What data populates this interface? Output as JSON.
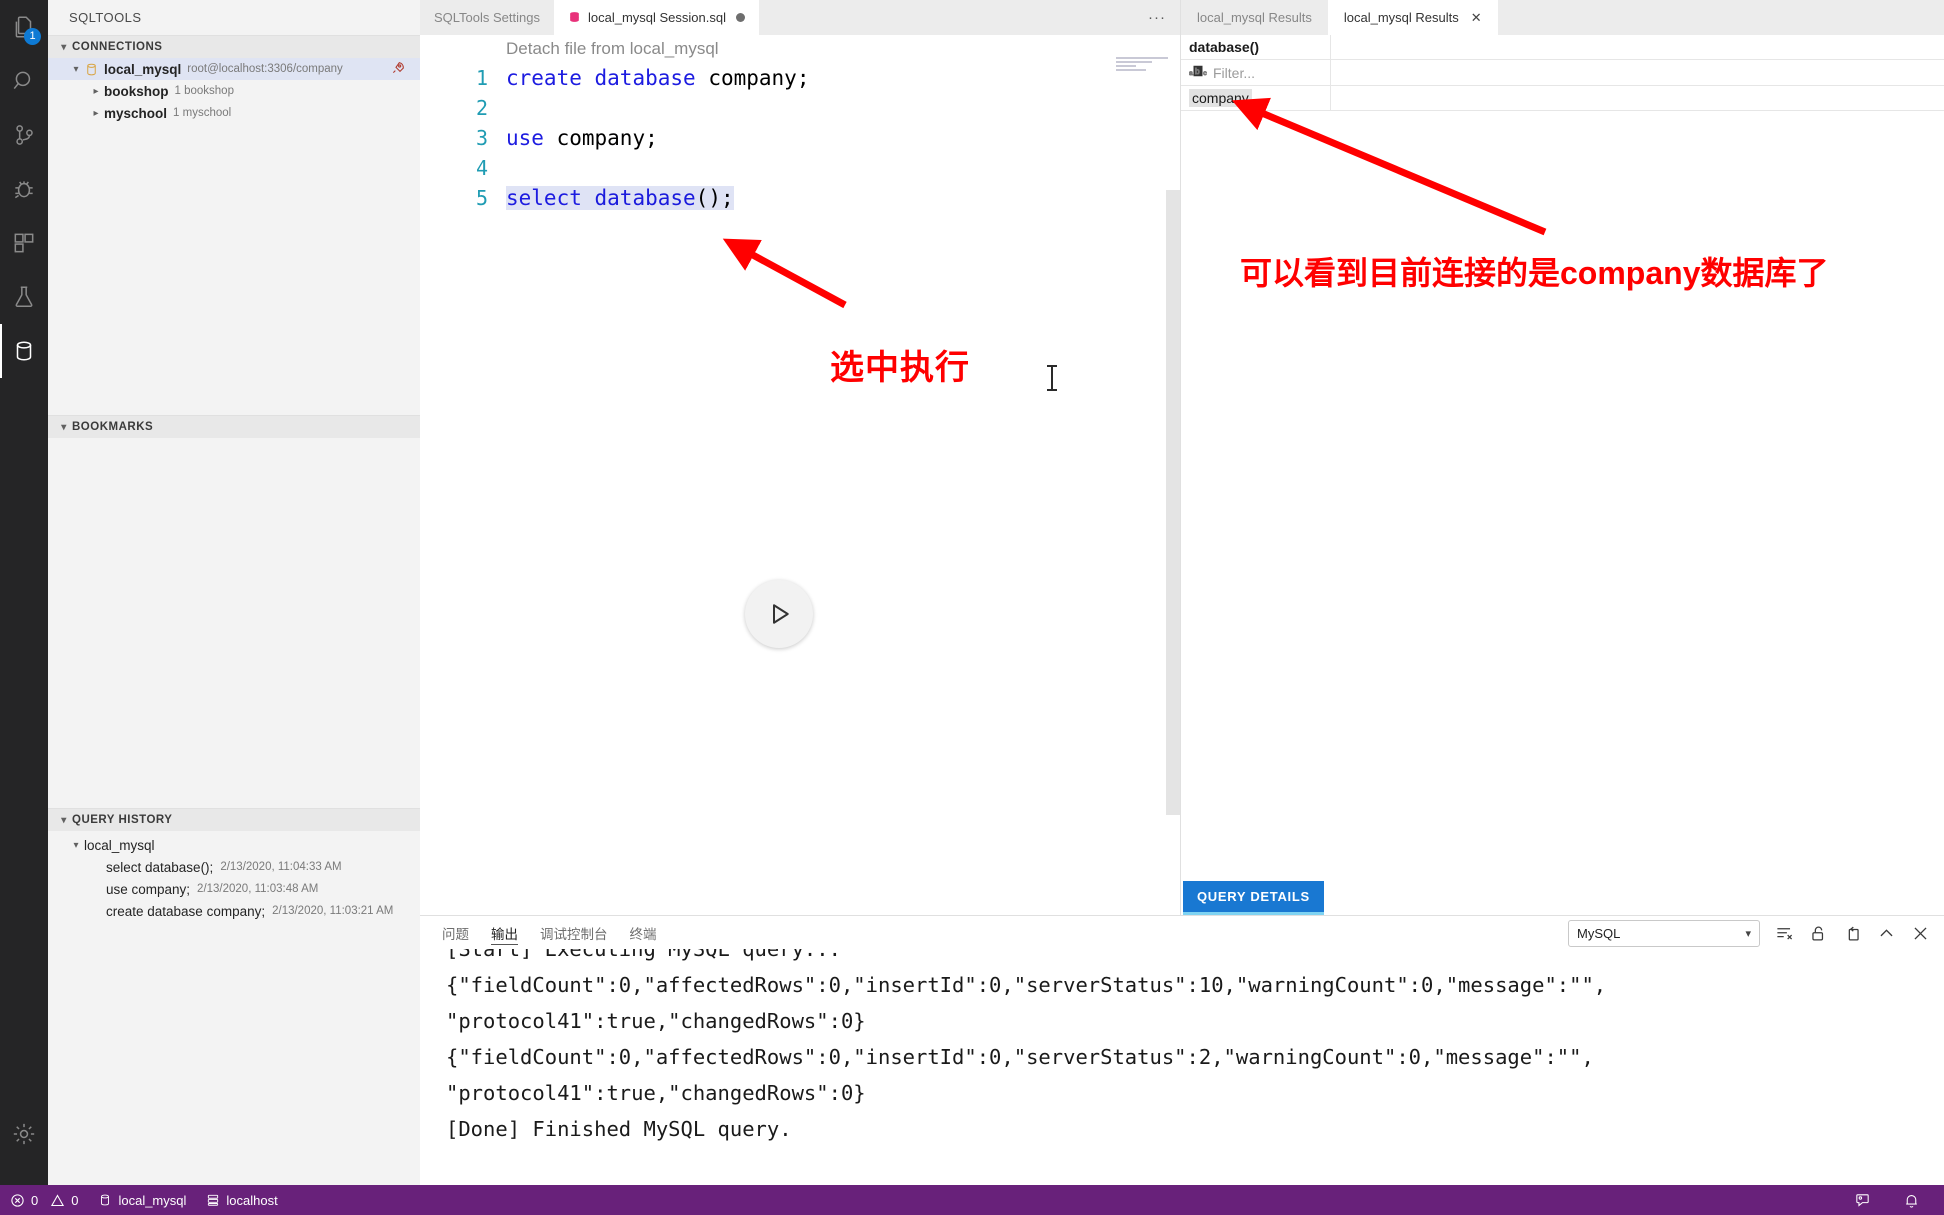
{
  "activitybar": {
    "items": [
      {
        "name": "explorer-icon",
        "label": "Explorer",
        "badge": "1"
      },
      {
        "name": "search-icon",
        "label": "Search",
        "badge": ""
      },
      {
        "name": "source-control-icon",
        "label": "Source Control",
        "badge": ""
      },
      {
        "name": "run-debug-icon",
        "label": "Run and Debug",
        "badge": ""
      },
      {
        "name": "extensions-icon",
        "label": "Extensions",
        "badge": ""
      },
      {
        "name": "testing-flask-icon",
        "label": "Testing",
        "badge": ""
      },
      {
        "name": "database-icon",
        "label": "SQLTools",
        "badge": ""
      }
    ],
    "settings_label": "Manage"
  },
  "sidebar": {
    "title": "SQLTOOLS",
    "sections": {
      "connections": {
        "label": "CONNECTIONS",
        "items": [
          {
            "name": "local_mysql",
            "detail": "root@localhost:3306/company",
            "level": 0,
            "expanded": true,
            "selected": true,
            "icon": "database-icon",
            "action_icon": "rocket-icon"
          },
          {
            "name": "bookshop",
            "detail": "1 bookshop",
            "level": 1,
            "expanded": false,
            "selected": false,
            "icon": "chevron-right-icon",
            "action_icon": ""
          },
          {
            "name": "myschool",
            "detail": "1 myschool",
            "level": 1,
            "expanded": false,
            "selected": false,
            "icon": "chevron-right-icon",
            "action_icon": ""
          }
        ]
      },
      "bookmarks": {
        "label": "BOOKMARKS",
        "items": []
      },
      "query_history": {
        "label": "QUERY HISTORY",
        "group": "local_mysql",
        "items": [
          {
            "query": "select database();",
            "time": "2/13/2020, 11:04:33 AM"
          },
          {
            "query": "use company;",
            "time": "2/13/2020, 11:03:48 AM"
          },
          {
            "query": "create database company;",
            "time": "2/13/2020, 11:03:21 AM"
          }
        ]
      }
    }
  },
  "editor": {
    "tabs": [
      {
        "label": "SQLTools Settings",
        "active": false,
        "dirty": false,
        "icon": ""
      },
      {
        "label": "local_mysql Session.sql",
        "active": true,
        "dirty": true,
        "icon": "sql-file-icon"
      }
    ],
    "overflow_label": "···",
    "codelens": "Detach file from local_mysql",
    "lines": [
      {
        "num": "1",
        "tokens": [
          {
            "t": "create",
            "c": "kw"
          },
          {
            "t": " ",
            "c": ""
          },
          {
            "t": "database",
            "c": "kw"
          },
          {
            "t": " company;",
            "c": ""
          }
        ],
        "selected": false
      },
      {
        "num": "2",
        "tokens": [],
        "selected": false
      },
      {
        "num": "3",
        "tokens": [
          {
            "t": "use",
            "c": "kw"
          },
          {
            "t": " company;",
            "c": ""
          }
        ],
        "selected": false
      },
      {
        "num": "4",
        "tokens": [],
        "selected": false
      },
      {
        "num": "5",
        "tokens": [
          {
            "t": "select",
            "c": "kw"
          },
          {
            "t": " ",
            "c": ""
          },
          {
            "t": "database",
            "c": "fn"
          },
          {
            "t": "();",
            "c": ""
          }
        ],
        "selected": true
      }
    ],
    "run_button_label": "Run query",
    "toolbar": {
      "run": "run-icon",
      "split": "split-editor-icon",
      "more": "more-actions-icon"
    }
  },
  "results": {
    "tabs": [
      {
        "label": "local_mysql Results",
        "active": false,
        "closable": false
      },
      {
        "label": "local_mysql Results",
        "active": true,
        "closable": true
      }
    ],
    "columns": [
      "database()",
      ""
    ],
    "filter_placeholder": "Filter...",
    "rows": [
      [
        "company",
        ""
      ]
    ],
    "query_details_label": "QUERY DETAILS"
  },
  "panel": {
    "tabs": [
      {
        "label": "问题",
        "active": false
      },
      {
        "label": "输出",
        "active": true
      },
      {
        "label": "调试控制台",
        "active": false
      },
      {
        "label": "终端",
        "active": false
      }
    ],
    "channel": "MySQL",
    "actions": [
      {
        "name": "clear-output-icon",
        "label": "Clear Output"
      },
      {
        "name": "lock-scroll-icon",
        "label": "Turn Auto Scrolling Off"
      },
      {
        "name": "open-in-editor-icon",
        "label": "Open Output in Editor"
      },
      {
        "name": "chevron-up-icon",
        "label": "Maximize Panel Size"
      },
      {
        "name": "close-icon",
        "label": "Close Panel"
      }
    ],
    "output_lines": [
      "[Start] Executing MySQL query...",
      "{\"fieldCount\":0,\"affectedRows\":0,\"insertId\":0,\"serverStatus\":10,\"warningCount\":0,\"message\":\"\",",
      "\"protocol41\":true,\"changedRows\":0}",
      "{\"fieldCount\":0,\"affectedRows\":0,\"insertId\":0,\"serverStatus\":2,\"warningCount\":0,\"message\":\"\",",
      "\"protocol41\":true,\"changedRows\":0}",
      "[Done] Finished MySQL query."
    ]
  },
  "statusbar": {
    "errors": "0",
    "warnings": "0",
    "connection": "local_mysql",
    "host": "localhost",
    "right_items": [
      {
        "name": "feedback-icon",
        "label": "Tweet Feedback"
      },
      {
        "name": "bell-icon",
        "label": "Notifications"
      }
    ]
  },
  "annotations": [
    {
      "name": "annotation-select-execute",
      "text": "选中执行"
    },
    {
      "name": "annotation-current-db",
      "text": "可以看到目前连接的是company数据库了"
    }
  ],
  "colors": {
    "accent_blue": "#1978d2",
    "statusbar_purple": "#68217a",
    "annotation_red": "#ff0000",
    "keyword_blue": "#1d1ce0",
    "linenumber_teal": "#1f9cb3",
    "selection_lavender": "#dfe3f5"
  }
}
